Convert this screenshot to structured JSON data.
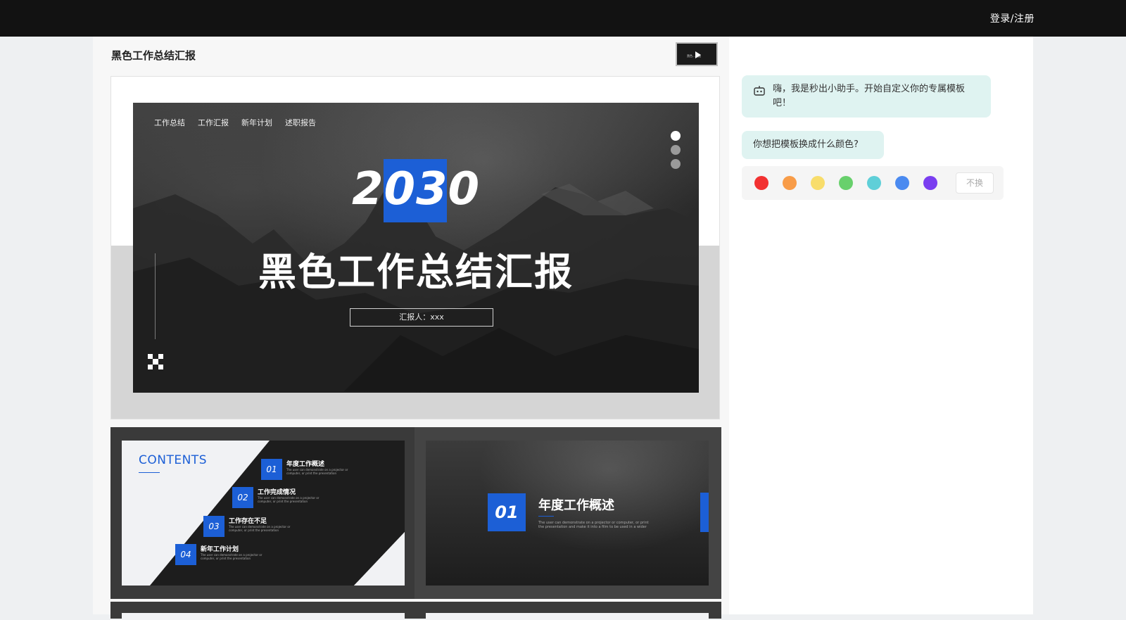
{
  "header": {
    "login_label": "登录/注册"
  },
  "document": {
    "title": "黑色工作总结汇报"
  },
  "main_slide": {
    "nav_tabs": [
      "工作总结",
      "工作汇报",
      "新年计划",
      "述职报告"
    ],
    "year": "2030",
    "title": "黑色工作总结汇报",
    "reporter": "汇报人：xxx",
    "page_indicator_count": 3,
    "active_page": 1
  },
  "thumbnails": {
    "contents": {
      "title": "CONTENTS",
      "items": [
        {
          "num": "01",
          "label": "年度工作概述",
          "sub": "The user can demonstrate on a projector or computer, or print the presentation"
        },
        {
          "num": "02",
          "label": "工作完成情况",
          "sub": "The user can demonstrate on a projector or computer, or print the presentation"
        },
        {
          "num": "03",
          "label": "工作存在不足",
          "sub": "The user can demonstrate on a projector or computer, or print the presentation"
        },
        {
          "num": "04",
          "label": "新年工作计划",
          "sub": "The user can demonstrate on a projector or computer, or print the presentation"
        }
      ]
    },
    "section": {
      "num": "01",
      "title": "年度工作概述",
      "sub": "The user can demonstrate on a projector or computer, or print the presentation and make it into a film to be used in a wider"
    }
  },
  "assistant": {
    "greeting": "嗨，我是秒出小助手。开始自定义你的专属模板吧！",
    "question": "你想把模板换成什么颜色?",
    "colors": [
      {
        "name": "red",
        "hex": "#f23131"
      },
      {
        "name": "orange",
        "hex": "#f89c48"
      },
      {
        "name": "yellow",
        "hex": "#f8dd6b"
      },
      {
        "name": "green",
        "hex": "#68d06c"
      },
      {
        "name": "cyan",
        "hex": "#5fcfd8"
      },
      {
        "name": "blue",
        "hex": "#4a8af0"
      },
      {
        "name": "purple",
        "hex": "#7a3ef0"
      }
    ],
    "keep_label": "不换"
  },
  "theme": {
    "accent": "#1c5fd6",
    "topbar": "#121212",
    "bubble": "#dff3f1"
  }
}
